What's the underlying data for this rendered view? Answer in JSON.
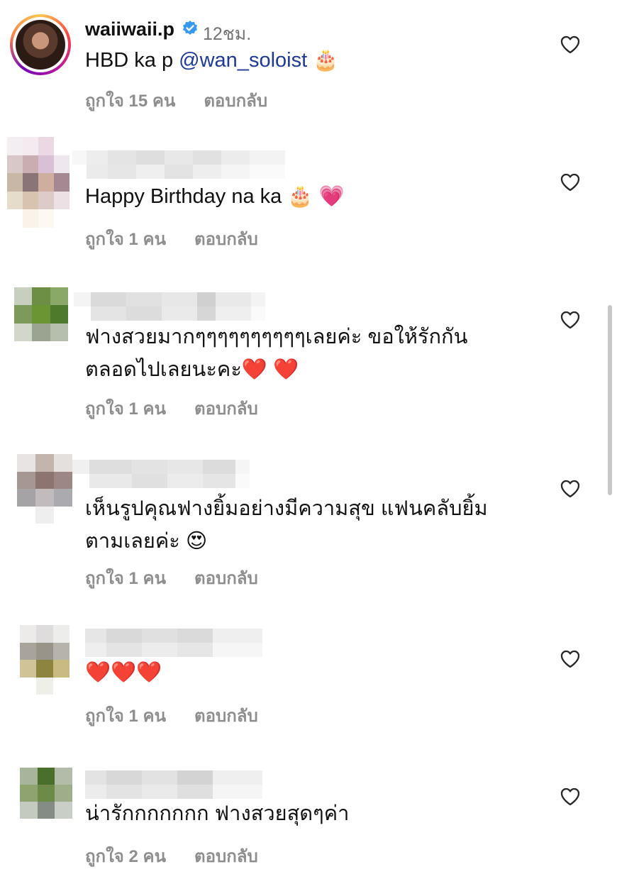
{
  "comments": [
    {
      "username": "waiiwaii.p",
      "time": "12ชม.",
      "text_pre": "HBD ka p ",
      "mention": "@wan_soloist",
      "emoji": "🎂",
      "likes": "ถูกใจ 15 คน",
      "reply": "ตอบกลับ"
    },
    {
      "text": "Happy Birthday na ka 🎂 💗",
      "likes": "ถูกใจ 1 คน",
      "reply": "ตอบกลับ"
    },
    {
      "text_line1": "ฟางสวยมากๆๆๆๆๆๆๆๆๆๆเลยค่ะ ขอให้รักกัน",
      "text_line2": "ตลอดไปเลยนะคะ❤️ ❤️",
      "likes": "ถูกใจ 1 คน",
      "reply": "ตอบกลับ"
    },
    {
      "text_line1": "เห็นรูปคุณฟางยิ้มอย่างมีความสุข แฟนคลับยิ้ม",
      "text_line2": "ตามเลยค่ะ 😍",
      "likes": "ถูกใจ 1 คน",
      "reply": "ตอบกลับ"
    },
    {
      "text": "❤️❤️❤️",
      "likes": "ถูกใจ 1 คน",
      "reply": "ตอบกลับ"
    },
    {
      "text": "น่ารักกกกกกก ฟางสวยสุดๆค่า",
      "likes": "ถูกใจ 2 คน",
      "reply": "ตอบกลับ"
    }
  ],
  "icons": {
    "like": "heart-outline-icon",
    "verified": "verified-badge-icon"
  },
  "colors": {
    "mention": "#1f3a93",
    "meta": "#8e8e8e",
    "verified": "#3897f0"
  }
}
